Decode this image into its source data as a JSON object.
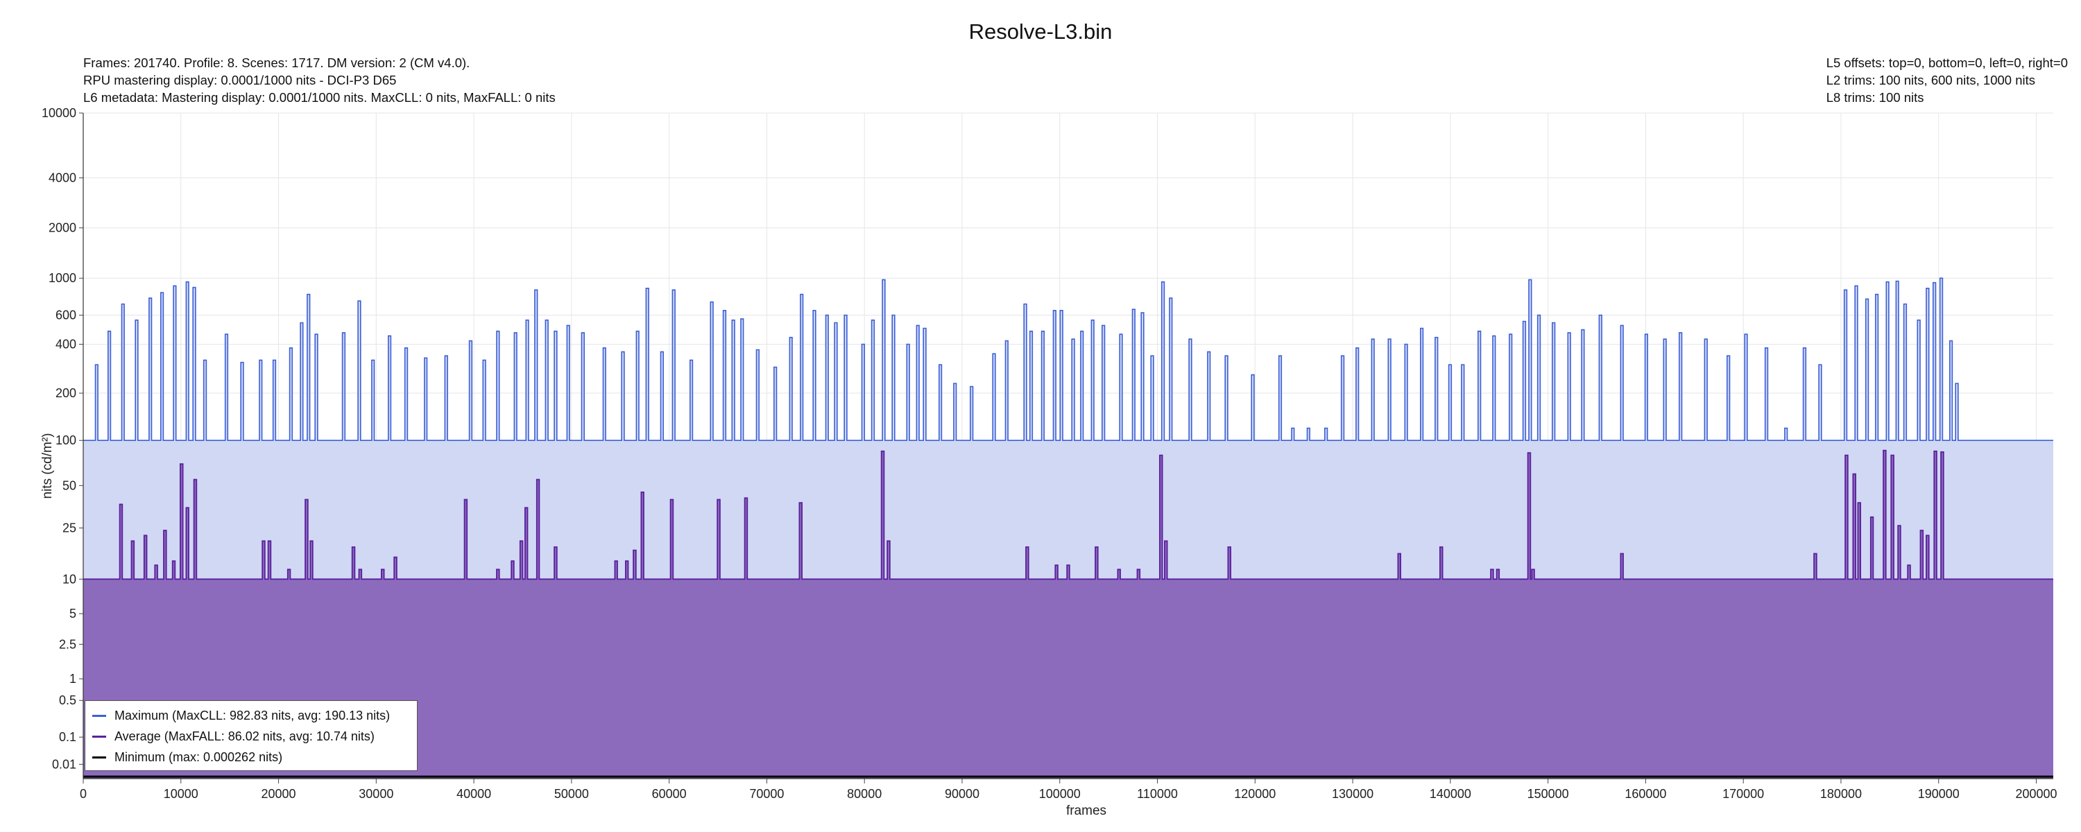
{
  "chart_data": {
    "type": "area",
    "title": "Resolve-L3.bin",
    "info_left": [
      "Frames: 201740. Profile: 8. Scenes: 1717. DM version: 2 (CM v4.0).",
      "RPU mastering display: 0.0001/1000 nits - DCI-P3 D65",
      "L6 metadata: Mastering display: 0.0001/1000 nits. MaxCLL: 0 nits, MaxFALL: 0 nits"
    ],
    "info_right": [
      "L5 offsets: top=0, bottom=0, left=0, right=0",
      "L2 trims: 100 nits, 600 nits, 1000 nits",
      "L8 trims: 100 nits"
    ],
    "xlabel": "frames",
    "ylabel": "nits (cd/m²)",
    "xlim": [
      0,
      201740
    ],
    "x_ticks": [
      "0",
      "10000",
      "20000",
      "30000",
      "40000",
      "50000",
      "60000",
      "70000",
      "80000",
      "90000",
      "100000",
      "110000",
      "120000",
      "130000",
      "140000",
      "150000",
      "160000",
      "170000",
      "180000",
      "190000",
      "200000"
    ],
    "y_ticks": [
      "0.01",
      "0.1",
      "0.5",
      "1",
      "2.5",
      "5",
      "10",
      "25",
      "50",
      "100",
      "200",
      "400",
      "600",
      "1000",
      "2000",
      "4000",
      "10000"
    ],
    "y_scale": "PQ (perceptual quantizer)",
    "grid": true,
    "legend_position": "bottom-left",
    "colors": {
      "maximum_line": "#3b5fd6",
      "maximum_fill": "#d0d8f4",
      "average_line": "#5a1f9c",
      "average_fill": "#8c6bbd",
      "minimum_line": "#000000",
      "grid": "#e6e6e6"
    },
    "series": [
      {
        "name": "Maximum (MaxCLL: 982.83 nits, avg: 190.13 nits)",
        "baseline": 100,
        "spikes": [
          [
            1500,
            300
          ],
          [
            2800,
            480
          ],
          [
            4200,
            700
          ],
          [
            5600,
            560
          ],
          [
            7000,
            760
          ],
          [
            8200,
            820
          ],
          [
            9500,
            900
          ],
          [
            10800,
            950
          ],
          [
            11500,
            880
          ],
          [
            12600,
            320
          ],
          [
            14800,
            460
          ],
          [
            16400,
            310
          ],
          [
            18300,
            320
          ],
          [
            19700,
            320
          ],
          [
            21400,
            380
          ],
          [
            22500,
            540
          ],
          [
            23200,
            800
          ],
          [
            24000,
            460
          ],
          [
            26800,
            470
          ],
          [
            28400,
            730
          ],
          [
            29800,
            320
          ],
          [
            31500,
            450
          ],
          [
            33200,
            380
          ],
          [
            35200,
            330
          ],
          [
            37300,
            340
          ],
          [
            39800,
            420
          ],
          [
            41200,
            320
          ],
          [
            42600,
            480
          ],
          [
            44400,
            470
          ],
          [
            45600,
            560
          ],
          [
            46500,
            850
          ],
          [
            47600,
            560
          ],
          [
            48500,
            480
          ],
          [
            49800,
            520
          ],
          [
            51300,
            470
          ],
          [
            53500,
            380
          ],
          [
            55400,
            360
          ],
          [
            56900,
            480
          ],
          [
            57900,
            870
          ],
          [
            59400,
            360
          ],
          [
            60600,
            850
          ],
          [
            62400,
            320
          ],
          [
            64500,
            720
          ],
          [
            65800,
            640
          ],
          [
            66700,
            560
          ],
          [
            67600,
            570
          ],
          [
            69200,
            370
          ],
          [
            71000,
            290
          ],
          [
            72600,
            440
          ],
          [
            73700,
            800
          ],
          [
            75000,
            640
          ],
          [
            76300,
            600
          ],
          [
            77200,
            540
          ],
          [
            78200,
            600
          ],
          [
            80000,
            400
          ],
          [
            81000,
            560
          ],
          [
            82100,
            980
          ],
          [
            83100,
            600
          ],
          [
            84600,
            400
          ],
          [
            85600,
            520
          ],
          [
            86300,
            500
          ],
          [
            87900,
            300
          ],
          [
            89400,
            230
          ],
          [
            91100,
            220
          ],
          [
            93400,
            350
          ],
          [
            94700,
            420
          ],
          [
            96600,
            700
          ],
          [
            97200,
            480
          ],
          [
            98400,
            480
          ],
          [
            99600,
            640
          ],
          [
            100300,
            640
          ],
          [
            101500,
            430
          ],
          [
            102400,
            480
          ],
          [
            103500,
            560
          ],
          [
            104600,
            520
          ],
          [
            106400,
            460
          ],
          [
            107700,
            650
          ],
          [
            108600,
            620
          ],
          [
            109600,
            340
          ],
          [
            110700,
            950
          ],
          [
            111500,
            760
          ],
          [
            113500,
            430
          ],
          [
            115400,
            360
          ],
          [
            117200,
            340
          ],
          [
            119900,
            260
          ],
          [
            122700,
            340
          ],
          [
            124000,
            120
          ],
          [
            125600,
            120
          ],
          [
            127400,
            120
          ],
          [
            129100,
            340
          ],
          [
            130600,
            380
          ],
          [
            132200,
            430
          ],
          [
            133900,
            430
          ],
          [
            135600,
            400
          ],
          [
            137200,
            500
          ],
          [
            138700,
            440
          ],
          [
            140100,
            300
          ],
          [
            141400,
            300
          ],
          [
            143100,
            480
          ],
          [
            144600,
            450
          ],
          [
            146300,
            460
          ],
          [
            147700,
            550
          ],
          [
            148300,
            980
          ],
          [
            149200,
            600
          ],
          [
            150700,
            540
          ],
          [
            152300,
            470
          ],
          [
            153700,
            490
          ],
          [
            155500,
            600
          ],
          [
            157700,
            520
          ],
          [
            160200,
            460
          ],
          [
            162100,
            430
          ],
          [
            163700,
            470
          ],
          [
            166300,
            430
          ],
          [
            168600,
            340
          ],
          [
            170400,
            460
          ],
          [
            172500,
            380
          ],
          [
            174500,
            120
          ],
          [
            176400,
            380
          ],
          [
            178000,
            300
          ],
          [
            180600,
            850
          ],
          [
            181700,
            900
          ],
          [
            182800,
            750
          ],
          [
            183800,
            800
          ],
          [
            184900,
            950
          ],
          [
            185900,
            960
          ],
          [
            186700,
            700
          ],
          [
            188100,
            560
          ],
          [
            189000,
            870
          ],
          [
            189700,
            940
          ],
          [
            190400,
            1000
          ],
          [
            191400,
            420
          ],
          [
            192000,
            230
          ]
        ],
        "end_value": 100
      },
      {
        "name": "Average (MaxFALL: 86.02 nits, avg: 10.74 nits)",
        "baseline": 10,
        "spikes": [
          [
            4000,
            37
          ],
          [
            5200,
            20
          ],
          [
            6500,
            22
          ],
          [
            7600,
            13
          ],
          [
            8500,
            24
          ],
          [
            9400,
            14
          ],
          [
            10200,
            70
          ],
          [
            10800,
            35
          ],
          [
            11600,
            55
          ],
          [
            18600,
            20
          ],
          [
            19200,
            20
          ],
          [
            21200,
            12
          ],
          [
            23000,
            40
          ],
          [
            23500,
            20
          ],
          [
            27800,
            18
          ],
          [
            28500,
            12
          ],
          [
            30800,
            12
          ],
          [
            32100,
            15
          ],
          [
            39300,
            40
          ],
          [
            42600,
            12
          ],
          [
            44100,
            14
          ],
          [
            45000,
            20
          ],
          [
            45500,
            35
          ],
          [
            46700,
            55
          ],
          [
            48500,
            18
          ],
          [
            54700,
            14
          ],
          [
            55800,
            14
          ],
          [
            56600,
            17
          ],
          [
            57400,
            45
          ],
          [
            60400,
            40
          ],
          [
            65200,
            40
          ],
          [
            68000,
            41
          ],
          [
            73600,
            38
          ],
          [
            82000,
            85
          ],
          [
            82600,
            20
          ],
          [
            96800,
            18
          ],
          [
            99800,
            13
          ],
          [
            101000,
            13
          ],
          [
            103900,
            18
          ],
          [
            106200,
            12
          ],
          [
            108200,
            12
          ],
          [
            110500,
            80
          ],
          [
            111000,
            20
          ],
          [
            117500,
            18
          ],
          [
            134900,
            16
          ],
          [
            139200,
            18
          ],
          [
            144400,
            12
          ],
          [
            145000,
            12
          ],
          [
            148200,
            83
          ],
          [
            148600,
            12
          ],
          [
            157700,
            16
          ],
          [
            177500,
            16
          ],
          [
            180700,
            80
          ],
          [
            181500,
            60
          ],
          [
            182000,
            38
          ],
          [
            183300,
            30
          ],
          [
            184600,
            86
          ],
          [
            185400,
            80
          ],
          [
            186100,
            26
          ],
          [
            187100,
            13
          ],
          [
            188400,
            24
          ],
          [
            189000,
            22
          ],
          [
            189800,
            85
          ],
          [
            190500,
            84
          ]
        ],
        "end_value": 10
      },
      {
        "name": "Minimum (max: 0.000262 nits)",
        "value": 0.000262
      }
    ]
  }
}
